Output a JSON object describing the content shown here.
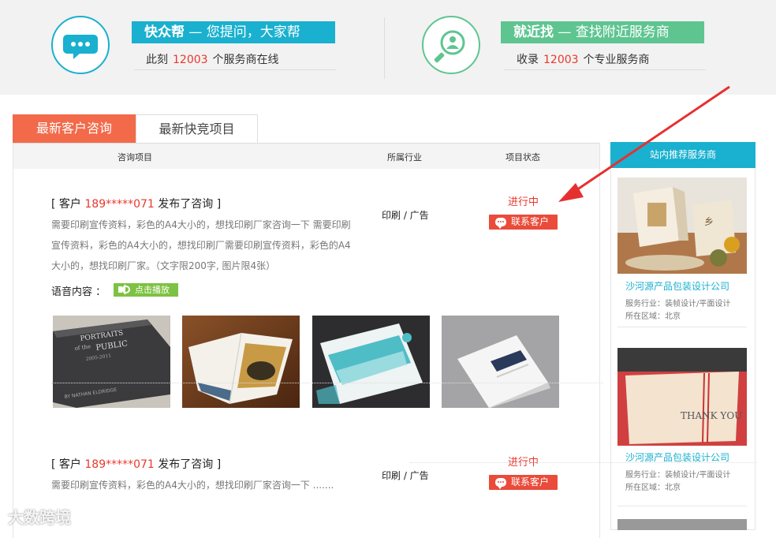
{
  "banner": {
    "left": {
      "title_bold": "快众帮",
      "title_rest": " — 您提问，大家帮",
      "sub_prefix": "此刻",
      "sub_number": "12003",
      "sub_suffix": "个服务商在线",
      "color": "#1ab0cf",
      "icon": "chat-bubble-icon"
    },
    "right": {
      "title_bold": "就近找",
      "title_rest": " — 查找附近服务商",
      "sub_prefix": "收录",
      "sub_number": "12003",
      "sub_suffix": "个专业服务商",
      "color": "#5ec591",
      "icon": "locate-person-icon"
    }
  },
  "tabs": [
    {
      "label": "最新客户咨询",
      "active": true
    },
    {
      "label": "最新快竞项目",
      "active": false
    }
  ],
  "table": {
    "headers": [
      "咨询项目",
      "所属行业",
      "项目状态"
    ]
  },
  "entries": [
    {
      "title_prefix": "[ 客户 ",
      "phone": "189*****071",
      "title_suffix": " 发布了咨询 ]",
      "desc": "需要印刷宣传资料，彩色的A4大小的，想找印刷厂家咨询一下 需要印刷宣传资料，彩色的A4大小的，想找印刷厂需要印刷宣传资料，彩色的A4大小的，想找印刷厂家。（文字限200字, 图片限4张）",
      "industry": "印刷 / 广告",
      "status": "进行中",
      "contact_label": "联系客户",
      "voice_label": "语音内容 ：",
      "play_label": "点击播放"
    },
    {
      "title_prefix": "[ 客户 ",
      "phone": "189*****071",
      "title_suffix": " 发布了咨询 ]",
      "desc": "需要印刷宣传资料，彩色的A4大小的，想找印刷厂家咨询一下 .......",
      "industry": "印刷 / 广告",
      "status": "进行中",
      "contact_label": "联系客户"
    }
  ],
  "thumbnails": [
    {
      "name": "portraits-book-thumb",
      "text_line1": "PORTRAITS",
      "text_line2": "of the",
      "text_line3": "PUBLIC",
      "text_line4": "2005-2011",
      "text_line5": "BY NATHAN ELDRIDGE"
    },
    {
      "name": "open-brochure-thumb"
    },
    {
      "name": "teal-brochure-thumb"
    },
    {
      "name": "white-catalog-thumb"
    }
  ],
  "sidebar": {
    "title": "站内推荐服务商",
    "items": [
      {
        "name": "沙河源产品包装设计公司",
        "industry": "服务行业：装帧设计/平面设计",
        "area": "所在区域：北京"
      },
      {
        "name": "沙河源产品包装设计公司",
        "industry": "服务行业：装帧设计/平面设计",
        "area": "所在区域：北京",
        "card_text": "THANK YOU"
      }
    ]
  },
  "watermark": "大数跨境"
}
